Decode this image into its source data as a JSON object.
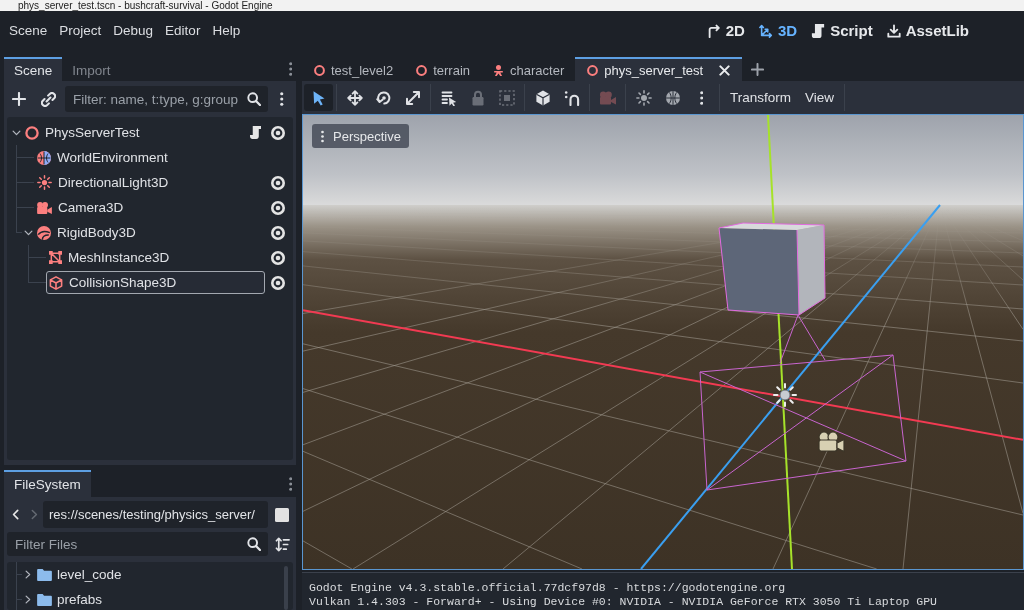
{
  "window": {
    "title": "phys_server_test.tscn - bushcraft-survival - Godot Engine"
  },
  "menu_bar": {
    "menus": [
      "Scene",
      "Project",
      "Debug",
      "Editor",
      "Help"
    ],
    "workspaces": [
      {
        "label": "2D",
        "kind": "canvas",
        "selected": false
      },
      {
        "label": "3D",
        "kind": "spatial",
        "selected": true
      },
      {
        "label": "Script",
        "kind": "script",
        "selected": false
      },
      {
        "label": "AssetLib",
        "kind": "assetlib",
        "selected": false
      }
    ]
  },
  "scene_dock": {
    "tabs": [
      {
        "label": "Scene",
        "selected": true
      },
      {
        "label": "Import",
        "selected": false
      }
    ],
    "filter": {
      "placeholder": "Filter: name, t:type, g:group"
    },
    "nodes": [
      {
        "name": "PhysServerTest",
        "kind": "node3d",
        "expanded": true,
        "selected": false,
        "script": true,
        "visibility_toggle": true,
        "children": [
          {
            "name": "WorldEnvironment",
            "kind": "environment",
            "selected": false,
            "script": false,
            "visibility_toggle": false
          },
          {
            "name": "DirectionalLight3D",
            "kind": "light",
            "selected": false,
            "script": false,
            "visibility_toggle": true
          },
          {
            "name": "Camera3D",
            "kind": "camera",
            "selected": false,
            "script": false,
            "visibility_toggle": true
          },
          {
            "name": "RigidBody3D",
            "kind": "rigidbody",
            "expanded": true,
            "selected": false,
            "script": false,
            "visibility_toggle": true,
            "children": [
              {
                "name": "MeshInstance3D",
                "kind": "mesh",
                "selected": false,
                "script": false,
                "visibility_toggle": true
              },
              {
                "name": "CollisionShape3D",
                "kind": "collision",
                "selected": true,
                "script": false,
                "visibility_toggle": true
              }
            ]
          }
        ]
      }
    ]
  },
  "filesystem_dock": {
    "tabs": [
      {
        "label": "FileSystem",
        "selected": true
      }
    ],
    "back": {
      "disabled": false
    },
    "forward": {
      "disabled": true
    },
    "path": "res://scenes/testing/physics_server/",
    "filter": {
      "placeholder": "Filter Files"
    },
    "items": [
      {
        "name": "level_code",
        "kind": "folder",
        "expanded": false
      },
      {
        "name": "prefabs",
        "kind": "folder",
        "expanded": false
      }
    ]
  },
  "editor": {
    "tabs": [
      {
        "label": "test_level2",
        "kind": "scene",
        "selected": false
      },
      {
        "label": "terrain",
        "kind": "scene",
        "selected": false
      },
      {
        "label": "character",
        "kind": "character",
        "selected": false
      },
      {
        "label": "phys_server_test",
        "kind": "scene",
        "selected": true
      }
    ],
    "tool_groups": [
      {
        "tools": [
          {
            "kind": "select",
            "selected": true,
            "disabled": false
          }
        ]
      },
      {
        "tools": [
          {
            "kind": "move",
            "selected": false,
            "disabled": false
          },
          {
            "kind": "rotate",
            "selected": false,
            "disabled": false
          },
          {
            "kind": "scale",
            "selected": false,
            "disabled": false
          }
        ]
      },
      {
        "tools": [
          {
            "kind": "list_select",
            "selected": false,
            "disabled": false
          },
          {
            "kind": "lock",
            "selected": false,
            "disabled": true
          },
          {
            "kind": "group",
            "selected": false,
            "disabled": true
          }
        ]
      },
      {
        "tools": [
          {
            "kind": "cube",
            "selected": false,
            "disabled": false
          },
          {
            "kind": "snap",
            "selected": false,
            "disabled": false
          }
        ]
      },
      {
        "tools": [
          {
            "kind": "camera",
            "selected": false,
            "disabled": true
          }
        ]
      },
      {
        "tools": [
          {
            "kind": "sun",
            "selected": false,
            "disabled": false
          },
          {
            "kind": "globe",
            "selected": false,
            "disabled": false
          },
          {
            "kind": "more",
            "selected": false,
            "disabled": false
          }
        ]
      }
    ],
    "menus": [
      "Transform",
      "View"
    ],
    "viewport": {
      "view_menu": "Perspective"
    }
  },
  "output": {
    "lines": [
      "Godot Engine v4.3.stable.official.77dcf97d8 - https://godotengine.org",
      "Vulkan 1.4.303 - Forward+ - Using Device #0: NVIDIA - NVIDIA GeForce RTX 3050 Ti Laptop GPU"
    ]
  }
}
